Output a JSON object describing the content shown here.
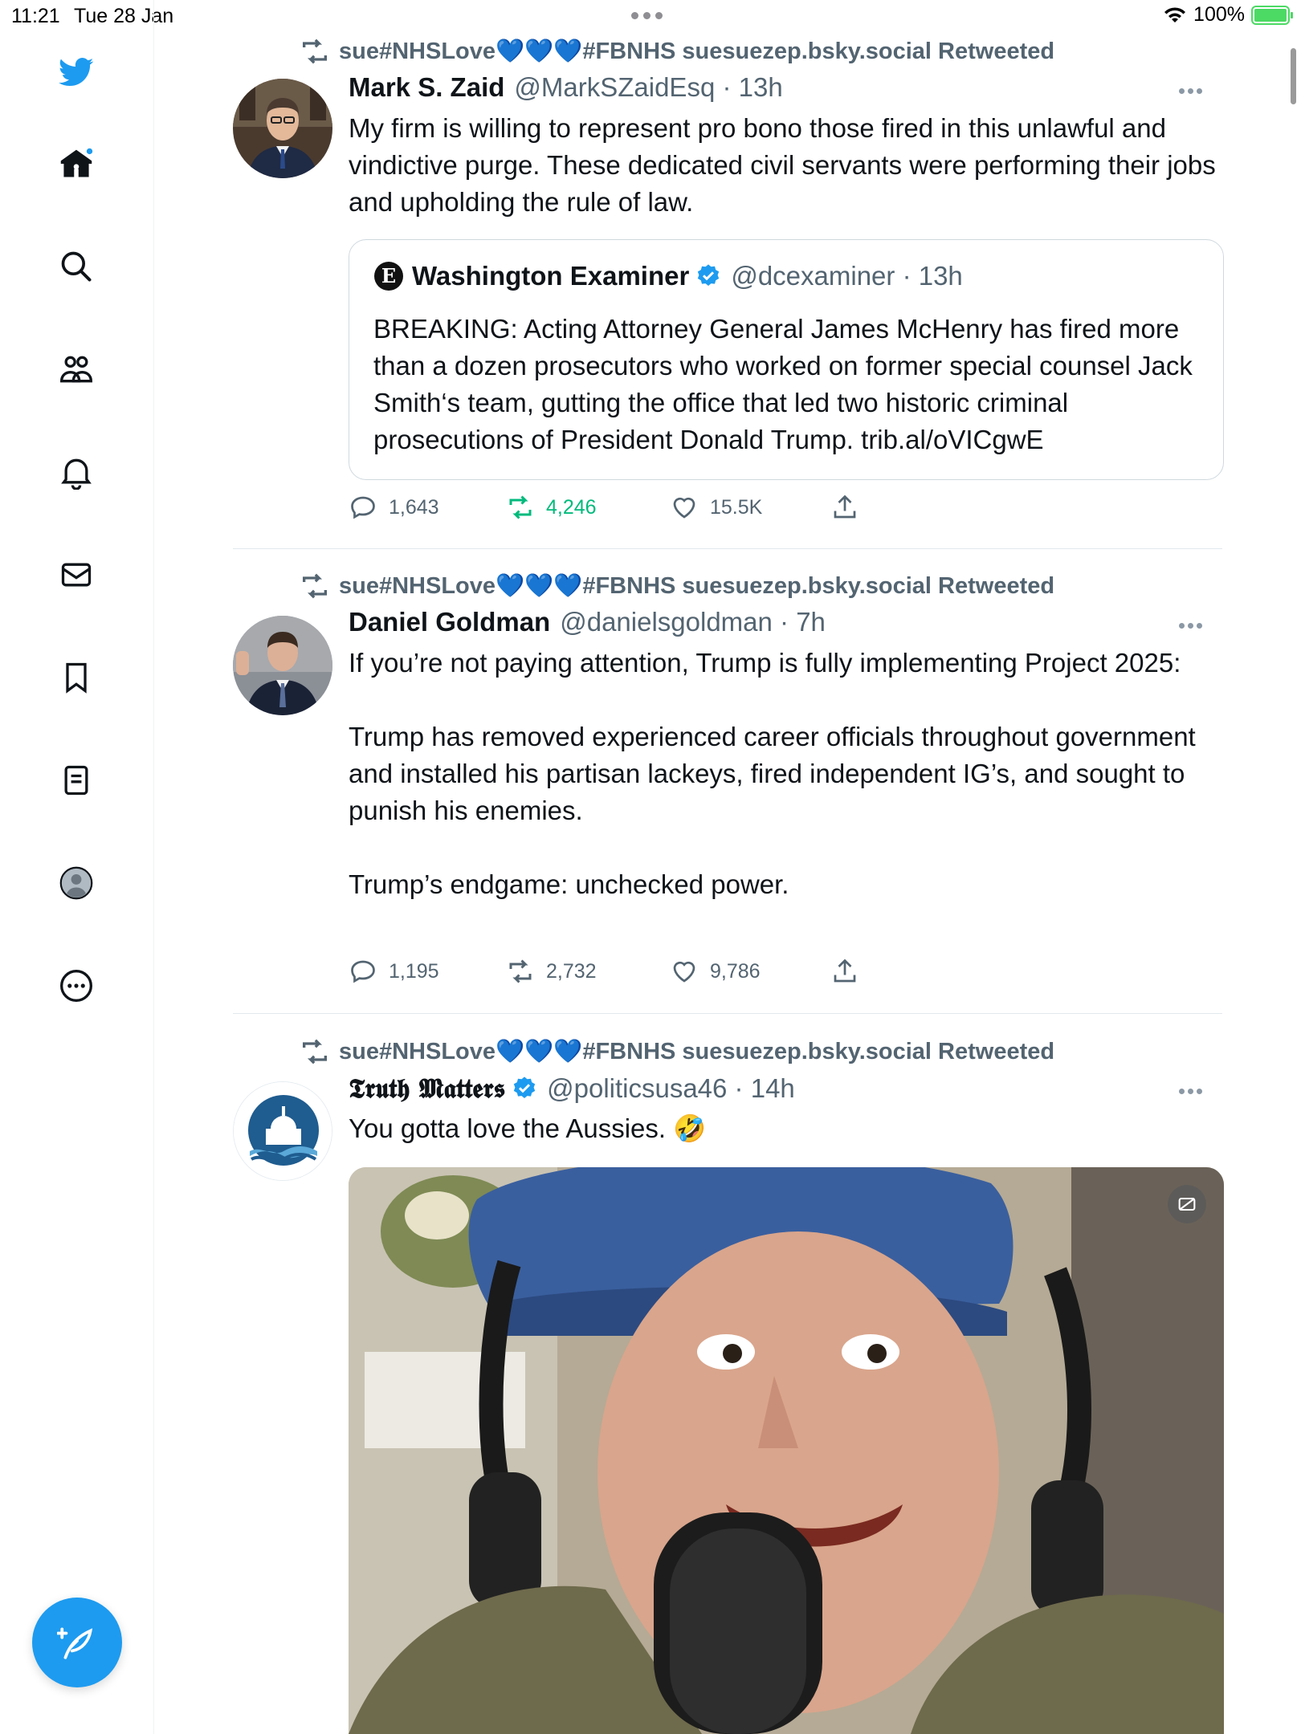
{
  "status_bar": {
    "time": "11:21",
    "date": "Tue 28 Jan",
    "battery": "100%"
  },
  "sidebar": {
    "items": [
      "home",
      "explore",
      "communities",
      "notifications",
      "messages",
      "bookmarks",
      "lists",
      "profile",
      "more"
    ]
  },
  "tweets": [
    {
      "retweeted_by": "sue#NHSLove💙💙💙#FBNHS suesuezep.bsky.social Retweeted",
      "name": "Mark S. Zaid",
      "handle": "@MarkSZaidEsq · 13h",
      "text": "My firm is willing to represent pro bono those fired in this unlawful and vindictive purge. These dedicated civil servants were performing their jobs and upholding the rule of law.",
      "quote": {
        "name": "Washington Examiner",
        "handle": "@dcexaminer · 13h",
        "text": "BREAKING: Acting Attorney General James McHenry has fired more than a dozen prosecutors who worked on former special counsel Jack Smith‘s team, gutting the office that led two historic criminal prosecutions of President Donald Trump. trib.al/oVICgwE"
      },
      "replies": "1,643",
      "retweets": "4,246",
      "likes": "15.5K"
    },
    {
      "retweeted_by": "sue#NHSLove💙💙💙#FBNHS suesuezep.bsky.social Retweeted",
      "name": "Daniel Goldman",
      "handle": "@danielsgoldman · 7h",
      "text": "If you’re not paying attention, Trump is fully implementing Project 2025:\n\nTrump has removed experienced career officials throughout government and installed his partisan lackeys, fired independent IG’s, and sought to punish his enemies.\n\nTrump’s endgame: unchecked power.",
      "replies": "1,195",
      "retweets": "2,732",
      "likes": "9,786"
    },
    {
      "retweeted_by": "sue#NHSLove💙💙💙#FBNHS suesuezep.bsky.social Retweeted",
      "name": "𝕿𝖗𝖚𝖙𝖍 𝕸𝖆𝖙𝖙𝖊𝖗𝖘",
      "handle": "@politicsusa46 · 14h",
      "text": "You gotta love the Aussies. 🤣"
    }
  ],
  "colors": {
    "accent": "#1d9bf0",
    "retweet_active": "#00ba7c",
    "secondary_text": "#536471"
  }
}
